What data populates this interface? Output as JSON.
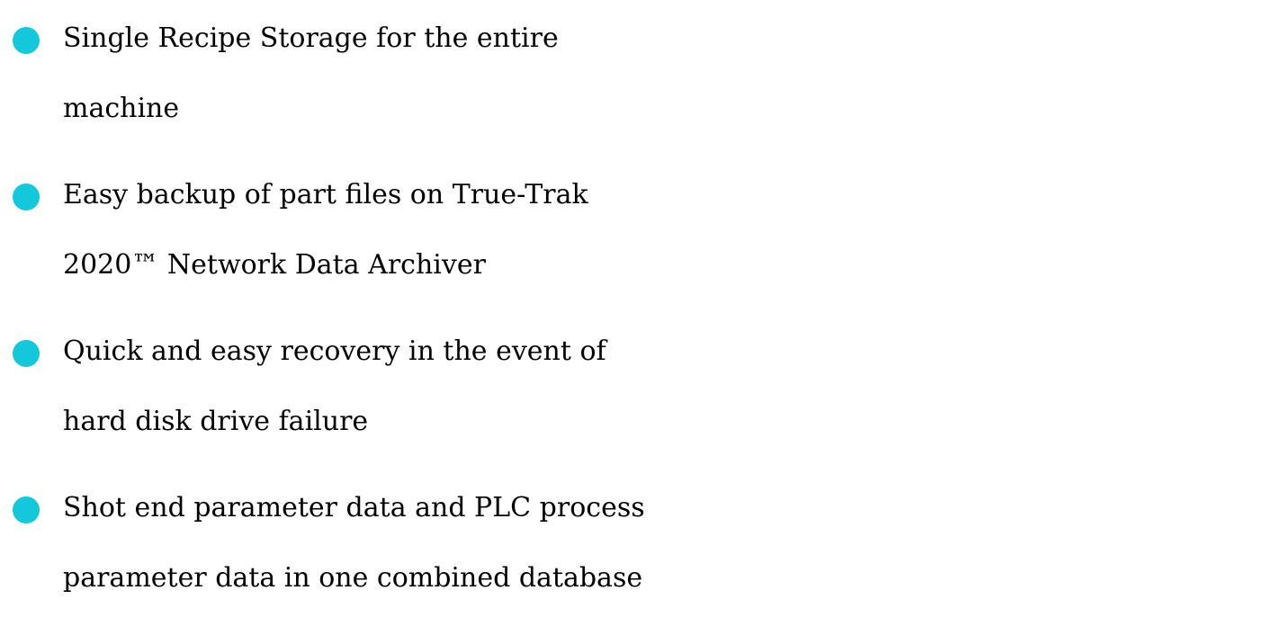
{
  "accent_color": "#14c8dc",
  "text_color": "#000000",
  "bullets": [
    {
      "icon": "bullet-dot",
      "line1": "Single Recipe Storage for the entire",
      "line2": "machine"
    },
    {
      "icon": "bullet-dot",
      "line1": "Easy backup of part files on True-Trak",
      "line2": "2020™ Network Data Archiver"
    },
    {
      "icon": "bullet-dot",
      "line1": "Quick and easy recovery in the event of",
      "line2": "hard disk drive failure"
    },
    {
      "icon": "bullet-dot",
      "line1": "Shot end parameter data and PLC process",
      "line2": "parameter data in one combined database"
    }
  ]
}
